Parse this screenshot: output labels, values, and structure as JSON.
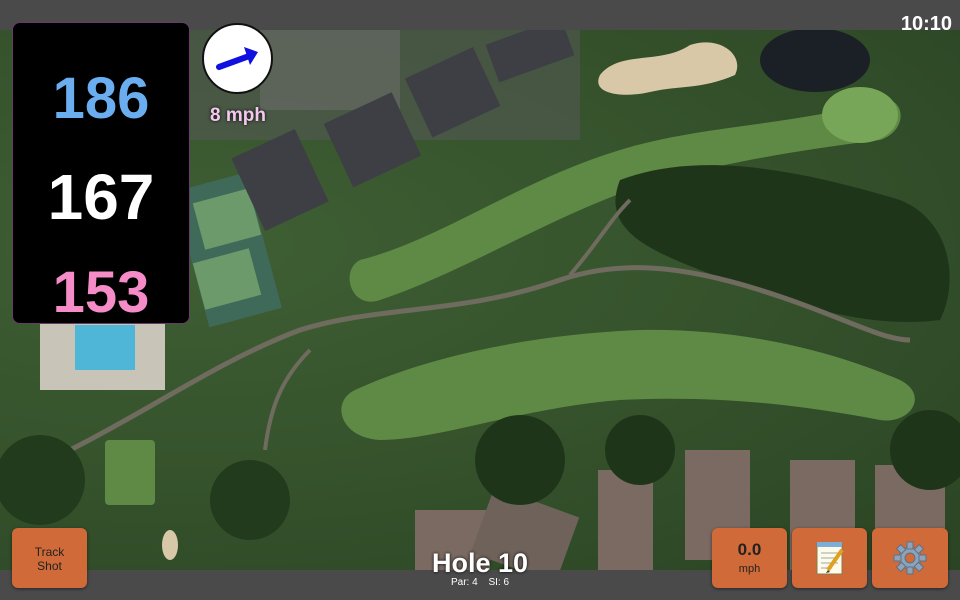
{
  "status": {
    "time": "10:10"
  },
  "distances": {
    "back": "186",
    "middle": "167",
    "front": "153"
  },
  "wind": {
    "speed": "8 mph",
    "direction_icon": "arrow-icon"
  },
  "hole": {
    "title": "Hole 10",
    "par": "Par: 4",
    "stroke_index": "SI: 6"
  },
  "buttons": {
    "track_shot_line1": "Track",
    "track_shot_line2": "Shot",
    "wind_value": "0.0",
    "wind_unit": "mph",
    "notes_icon": "notepad-icon",
    "settings_icon": "gear-icon"
  },
  "colors": {
    "back_distance": "#6aaef0",
    "middle_distance": "#ffffff",
    "front_distance": "#f58cc8",
    "button_bg": "#d06a38",
    "wind_text": "#f5c8f0"
  }
}
